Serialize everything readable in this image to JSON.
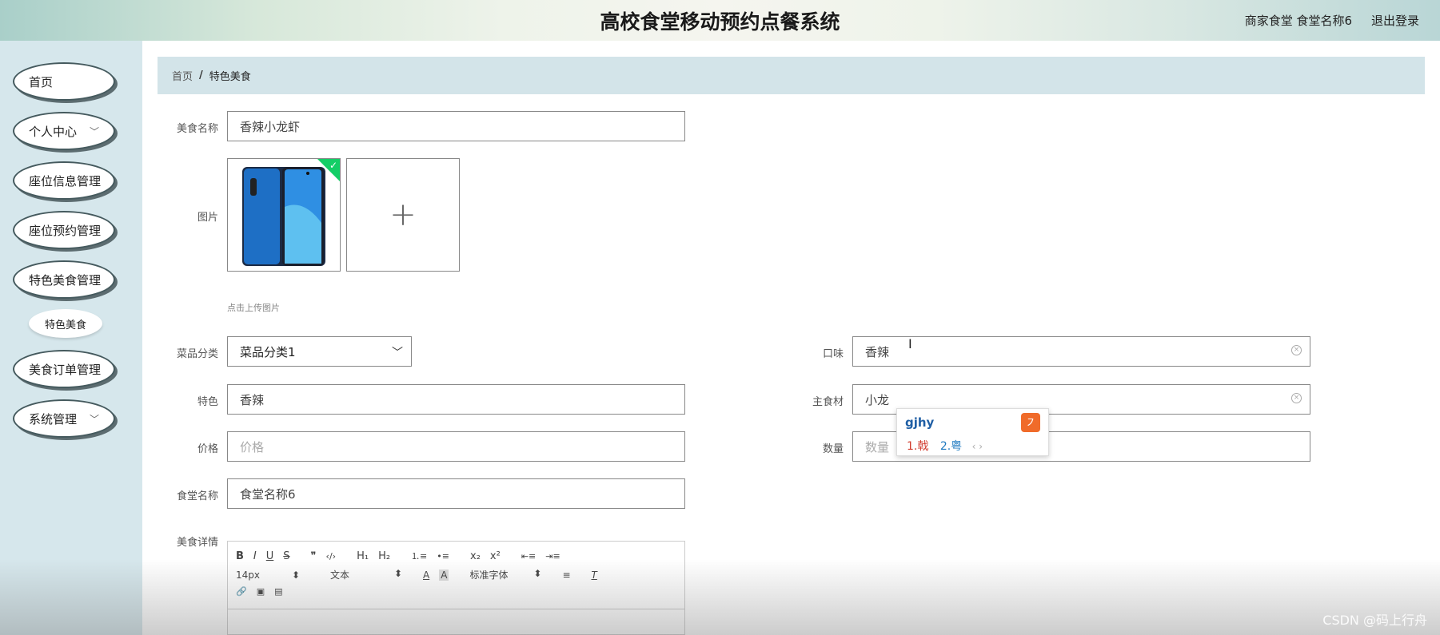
{
  "header": {
    "title": "高校食堂移动预约点餐系统",
    "user_info": "商家食堂 食堂名称6",
    "logout": "退出登录"
  },
  "sidebar": {
    "items": [
      {
        "label": "首页"
      },
      {
        "label": "个人中心",
        "chevron": "﹀"
      },
      {
        "label": "座位信息管理"
      },
      {
        "label": "座位预约管理"
      },
      {
        "label": "特色美食管理"
      },
      {
        "label": "美食订单管理"
      },
      {
        "label": "系统管理",
        "chevron": "﹀"
      }
    ],
    "sub_item": "特色美食"
  },
  "breadcrumb": {
    "home": "首页",
    "separator": "/",
    "current": "特色美食"
  },
  "form": {
    "name": {
      "label": "美食名称",
      "value": "香辣小龙虾"
    },
    "image": {
      "label": "图片",
      "tip": "点击上传图片",
      "add_symbol": "+"
    },
    "category": {
      "label": "菜品分类",
      "value": "菜品分类1"
    },
    "taste": {
      "label": "口味",
      "value": "香辣"
    },
    "feature": {
      "label": "特色",
      "value": "香辣"
    },
    "main_ingredient": {
      "label": "主食材",
      "value": "小龙"
    },
    "price": {
      "label": "价格",
      "placeholder": "价格"
    },
    "quantity": {
      "label": "数量",
      "placeholder": "数量"
    },
    "canteen": {
      "label": "食堂名称",
      "value": "食堂名称6"
    },
    "detail": {
      "label": "美食详情"
    }
  },
  "editor": {
    "row1": [
      "B",
      "I",
      "U",
      "S",
      "❞",
      "‹/›",
      "H₁",
      "H₂",
      "⒈≡",
      "•≡",
      "x₂",
      "x²",
      "⇤≡",
      "⇥≡"
    ],
    "font_size": "14px",
    "text_type": "文本",
    "font_family": "标准字体",
    "row3": [
      "🔗",
      "▣",
      "▤"
    ]
  },
  "ime": {
    "composition": "gjhy",
    "candidate1": "1.戟",
    "candidate2": "2.粤",
    "nav": "‹ ›",
    "logo": "㇇"
  },
  "watermark": "CSDN @码上行舟",
  "colors": {
    "sidebar_bg": "#d6e7ec",
    "breadcrumb_bg": "#d3e4e9",
    "upload_success": "#13ce66"
  }
}
